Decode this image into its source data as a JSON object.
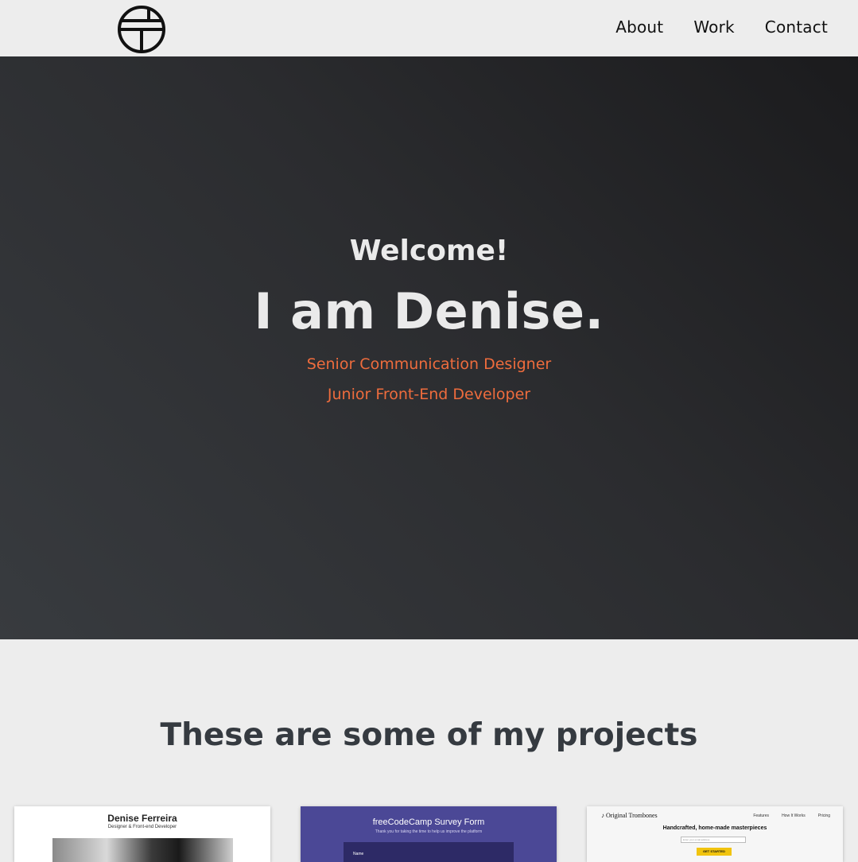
{
  "header": {
    "logo_icon": "circle-monogram-logo",
    "nav": [
      {
        "label": "About"
      },
      {
        "label": "Work"
      },
      {
        "label": "Contact"
      }
    ]
  },
  "hero": {
    "greeting": "Welcome!",
    "headline": "I am Denise.",
    "roles": [
      "Senior Communication Designer",
      "Junior Front-End Developer"
    ],
    "accent_color": "#ee6c3d"
  },
  "projects": {
    "title": "These are some of my projects",
    "cards": [
      {
        "name": "Denise Ferreira",
        "subtitle": "Designer & Front-end Developer"
      },
      {
        "title": "freeCodeCamp Survey Form",
        "description": "Thank you for taking the time to help us improve the platform",
        "field_label": "Name"
      },
      {
        "brand": "Original Trombones",
        "links": [
          "Features",
          "How It Works",
          "Pricing"
        ],
        "headline": "Handcrafted, home-made masterpieces",
        "email_placeholder": "Enter your email address",
        "cta": "GET STARTED",
        "cta_color": "#f1c40f"
      }
    ]
  }
}
